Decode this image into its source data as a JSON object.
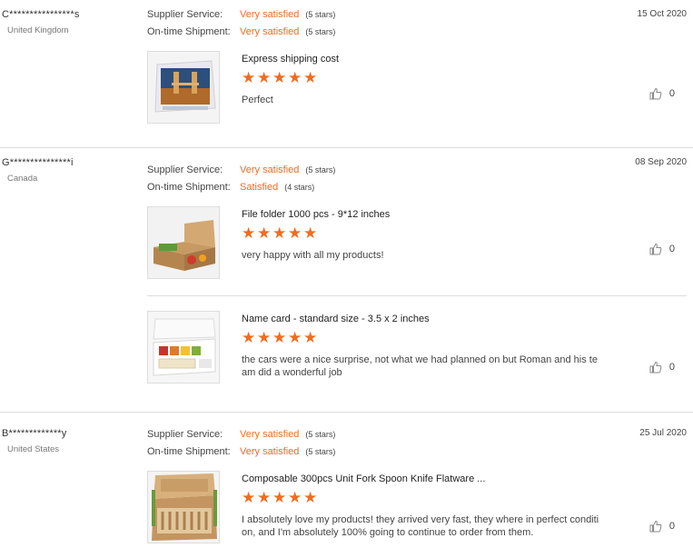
{
  "reviews": [
    {
      "buyer": "C****************s",
      "country": "United Kingdom",
      "date": "15 Oct 2020",
      "supplier_service": {
        "label": "Supplier Service:",
        "value": "Very satisfied",
        "stars_text": "(5 stars)"
      },
      "ontime_shipment": {
        "label": "On-time Shipment:",
        "value": "Very satisfied",
        "stars_text": "(5 stars)"
      },
      "items": [
        {
          "product": "Express shipping cost",
          "rating": 5,
          "comment": "Perfect",
          "likes": "0",
          "thumb": "puzzle-box-image"
        }
      ]
    },
    {
      "buyer": "G***************i",
      "country": "Canada",
      "date": "08 Sep 2020",
      "supplier_service": {
        "label": "Supplier Service:",
        "value": "Very satisfied",
        "stars_text": "(5 stars)"
      },
      "ontime_shipment": {
        "label": "On-time Shipment:",
        "value": "Satisfied",
        "stars_text": "(4 stars)"
      },
      "items": [
        {
          "product": "File folder 1000 pcs - 9*12 inches",
          "rating": 5,
          "comment": "very happy with all my products!",
          "likes": "0",
          "thumb": "kraft-food-box-image"
        },
        {
          "product": "Name card - standard size - 3.5 x 2 inches",
          "rating": 5,
          "comment": "the cars were a nice surprise, not what we had planned on but Roman and his team did a wonderful job",
          "likes": "0",
          "thumb": "compartment-tray-image"
        }
      ]
    },
    {
      "buyer": "B*************y",
      "country": "United States",
      "date": "25 Jul 2020",
      "supplier_service": {
        "label": "Supplier Service:",
        "value": "Very satisfied",
        "stars_text": "(5 stars)"
      },
      "ontime_shipment": {
        "label": "On-time Shipment:",
        "value": "Very satisfied",
        "stars_text": "(5 stars)"
      },
      "items": [
        {
          "product": "Composable 300pcs Unit Fork Spoon Knife Flatware ...",
          "rating": 5,
          "comment": "I absolutely love my products! they arrived very fast, they where in perfect condition, and I'm absolutely 100% going to continue to order from them.",
          "likes": "0",
          "thumb": "cutlery-box-image"
        }
      ]
    }
  ],
  "colors": {
    "accent": "#f06c1e",
    "divider": "#dddddd"
  }
}
